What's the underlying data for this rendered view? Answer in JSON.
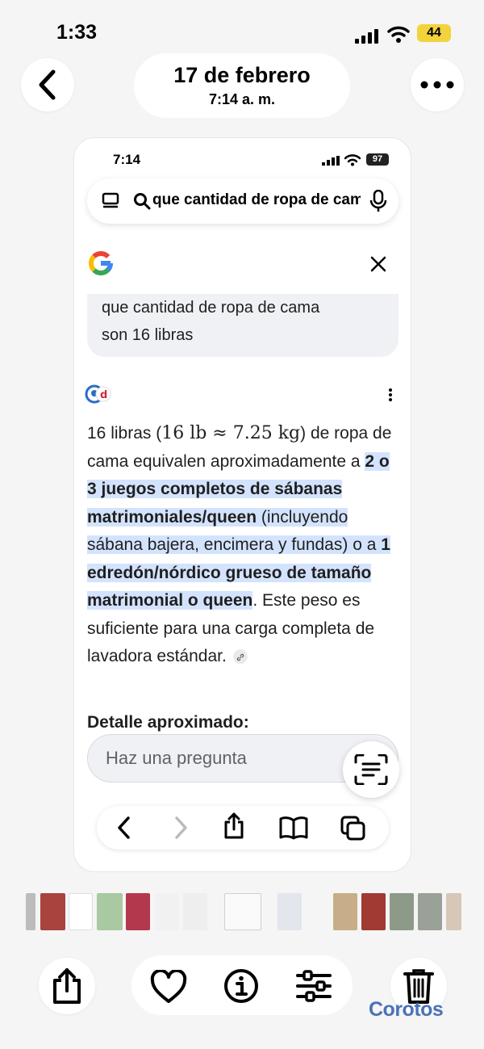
{
  "status_bar": {
    "time": "1:33",
    "battery": "44"
  },
  "header": {
    "date": "17 de febrero",
    "time": "7:14 a. m."
  },
  "inner": {
    "status": {
      "time": "7:14",
      "battery": "97"
    },
    "search": {
      "query": "que cantidad de ropa de cama son 16 libras"
    },
    "prompt": {
      "line1": "que cantidad de ropa de cama",
      "line2": "son 16 libras"
    },
    "answer": {
      "t1": "16 libras (",
      "math": "16 lb ≈ 7.25 kg",
      "t2": ") de ropa de cama equivalen aproximadamente a ",
      "b1": "2 o 3 juegos completos de sábanas matrimoniales/queen",
      "t3": " (incluyendo sábana bajera, encimera y fundas) o a ",
      "b2": "1 edredón/nórdico grueso de tamaño matrimonial o queen",
      "t4": ". Este peso es suficiente para una carga completa de lavadora estándar.",
      "cut_heading": "Detalle aproximado:"
    },
    "ask_placeholder": "Haz una pregunta"
  },
  "watermark": "Corotos",
  "colors": {
    "highlight": "#d3e3fd",
    "battery_yellow": "#f3d33b",
    "bubble": "#eff1f5"
  },
  "icons": {
    "header": [
      "back-icon",
      "more-icon"
    ],
    "nav": [
      "browser-back-icon",
      "browser-forward-icon",
      "share-icon",
      "bookmarks-icon",
      "tabs-icon"
    ],
    "toolbar": [
      "share-icon",
      "heart-icon",
      "info-icon",
      "adjust-icon",
      "trash-icon"
    ]
  }
}
